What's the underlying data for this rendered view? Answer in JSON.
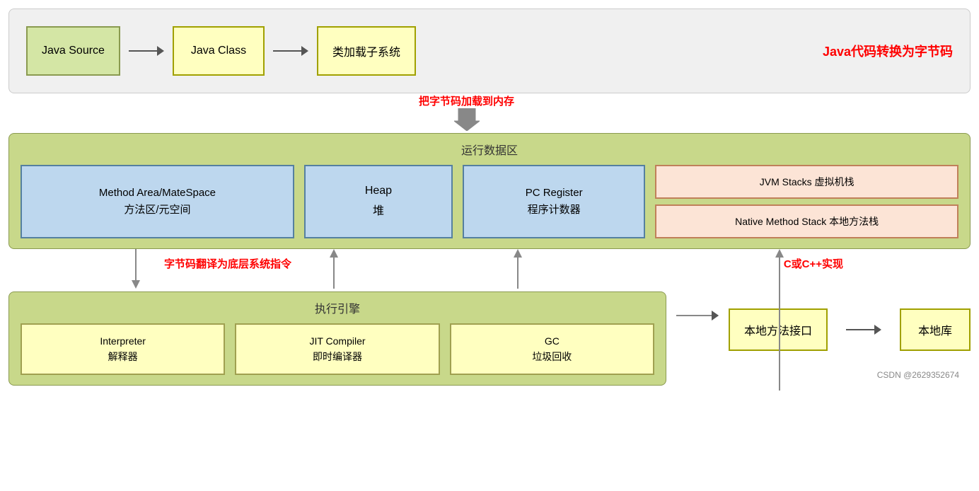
{
  "top": {
    "box1": "Java Source",
    "box2": "Java Class",
    "box3": "类加载子系统",
    "label": "Java代码转换为字节码"
  },
  "middle_arrow": {
    "label": "把字节码加载到内存"
  },
  "runtime": {
    "title": "运行数据区",
    "method_area": "Method Area/MateSpace\n方法区/元空间",
    "heap": "Heap\n堆",
    "pc_register": "PC Register\n程序计数器",
    "jvm_stacks": "JVM Stacks 虚拟机栈",
    "native_method_stack": "Native Method Stack 本地方法栈"
  },
  "exec": {
    "title": "执行引擎",
    "label": "字节码翻译为底层系统指令",
    "interpreter": "Interpreter\n解释器",
    "jit": "JIT Compiler\n即时编译器",
    "gc": "GC\n垃圾回收"
  },
  "native": {
    "label": "C或C++实现",
    "interface": "本地方法接口",
    "library": "本地库"
  },
  "watermark": "CSDN @2629352674"
}
